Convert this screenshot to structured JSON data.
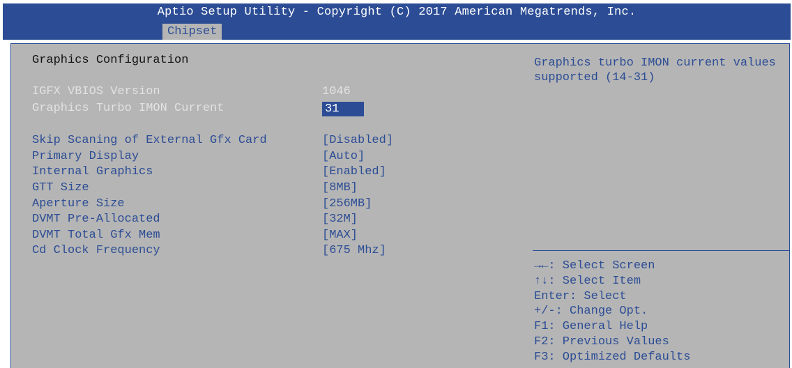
{
  "header": {
    "title": "Aptio Setup Utility - Copyright (C) 2017 American Megatrends, Inc.",
    "active_tab": "Chipset"
  },
  "main": {
    "section_title": "Graphics Configuration",
    "info": [
      {
        "label": "IGFX VBIOS Version",
        "value": "1046"
      }
    ],
    "selected": {
      "label": "Graphics Turbo IMON Current",
      "value": "31"
    },
    "settings": [
      {
        "label": "Skip Scaning of External Gfx Card",
        "value": "[Disabled]"
      },
      {
        "label": "Primary Display",
        "value": "[Auto]"
      },
      {
        "label": "Internal Graphics",
        "value": "[Enabled]"
      },
      {
        "label": "GTT Size",
        "value": "[8MB]"
      },
      {
        "label": "Aperture Size",
        "value": "[256MB]"
      },
      {
        "label": "DVMT Pre-Allocated",
        "value": "[32M]"
      },
      {
        "label": "DVMT Total Gfx Mem",
        "value": "[MAX]"
      },
      {
        "label": "Cd Clock Frequency",
        "value": "[675 Mhz]"
      }
    ]
  },
  "help": {
    "description": "Graphics turbo IMON current values supported (14-31)",
    "keys": [
      "→←: Select Screen",
      "↑↓: Select Item",
      "Enter: Select",
      "+/-: Change Opt.",
      "F1: General Help",
      "F2: Previous Values",
      "F3: Optimized Defaults"
    ]
  },
  "colors": {
    "accent": "#2c4d95",
    "panel": "#b5b5b5",
    "text": "#2c4d95",
    "dimmed": "#e2e2e2"
  }
}
